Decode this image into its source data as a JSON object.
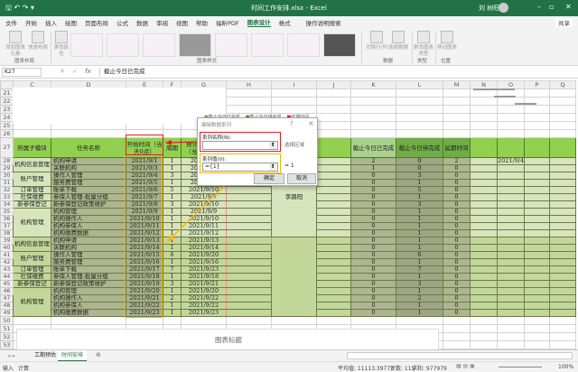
{
  "window": {
    "title": "时间工作安排.xlsx - Excel",
    "user": "刘 树旺",
    "share": "共享"
  },
  "menu": [
    "文件",
    "开始",
    "插入",
    "绘图",
    "页面布局",
    "公式",
    "数据",
    "审阅",
    "视图",
    "帮助",
    "福昕PDF",
    "图表设计",
    "格式"
  ],
  "menu_active": "图表设计",
  "tell_me": "操作说明搜索",
  "ribbon": {
    "add_element": "添加图表元素",
    "quick_layout": "快速布局",
    "change_colors": "更改颜色",
    "switch_row_col": "切换行/列",
    "select_data": "选择数据",
    "change_type": "更改图表类型",
    "move_chart": "移动图表",
    "groups": {
      "layout": "图表布局",
      "styles": "图表样式",
      "data": "数据",
      "type": "类型",
      "location": "位置"
    }
  },
  "formula": {
    "name_box": "K27",
    "value": "截止今日已完成",
    "fx": "fx"
  },
  "columns": [
    "C",
    "D",
    "E",
    "F",
    "G",
    "H",
    "I",
    "J",
    "K",
    "L",
    "M",
    "N",
    "O",
    "P",
    "Q"
  ],
  "top_rows": [
    {
      "row": 21,
      "c": "2021/9/21"
    },
    {
      "row": 22,
      "c": "2021/9/22"
    },
    {
      "row": 23,
      "c": "2021/9/23"
    },
    {
      "row": 24,
      "c": ""
    },
    {
      "row": 25,
      "c": ""
    },
    {
      "row": 26,
      "c": ""
    }
  ],
  "chart_legend": [
    "截止今日已完成",
    "截止今日待完成",
    "延期时间"
  ],
  "header": {
    "row": 27,
    "module": "所属子模块",
    "task": "任务名称",
    "start": "开始时间（当天0点）",
    "period": "周期",
    "end": "预计结束时间（当天24点）",
    "done": "截止今日已完成",
    "todo": "截止今日待完成",
    "delay": "延期时间"
  },
  "owner": "李路阳",
  "o28": "2021/9/4",
  "rows": [
    [
      28,
      "机构信息管理",
      "机构申请",
      "2021/9/1",
      "1",
      "2021/9/1",
      "2",
      "0",
      "2"
    ],
    [
      29,
      "",
      "关联机构",
      "2021/9/3",
      "1",
      "2021/9/3",
      "1",
      "0",
      "0"
    ],
    [
      30,
      "账户管理",
      "操作人管理",
      "2021/9/4",
      "3",
      "2021/9/6",
      "0",
      "3",
      "0"
    ],
    [
      31,
      "",
      "服务费管理",
      "2021/9/5",
      "1",
      "2021/9/5",
      "0",
      "1",
      "0"
    ],
    [
      32,
      "订单管理",
      "账单下载",
      "2021/9/6",
      "5",
      "2021/9/10",
      "0",
      "5",
      "0"
    ],
    [
      33,
      "社保缴费",
      "参保人管理-批量分组",
      "2021/9/7",
      "1",
      "2021/9/7",
      "0",
      "1",
      "0"
    ],
    [
      34,
      "新参保登记",
      "新参保登记政策维护",
      "2021/9/8",
      "3",
      "2021/9/10",
      "0",
      "3",
      "0"
    ],
    [
      35,
      "机构管理",
      "机构管理",
      "2021/9/9",
      "1",
      "2021/9/9",
      "0",
      "1",
      "0"
    ],
    [
      36,
      "",
      "机构操作人",
      "2021/9/10",
      "1",
      "2021/9/10",
      "0",
      "1",
      "0"
    ],
    [
      37,
      "",
      "机构参保人",
      "2021/9/11",
      "1",
      "2021/9/11",
      "0",
      "1",
      "0"
    ],
    [
      38,
      "",
      "机构缴费数据",
      "2021/9/12",
      "1",
      "2021/9/12",
      "0",
      "1",
      "0"
    ],
    [
      39,
      "机构信息管理",
      "机构申请",
      "2021/9/13",
      "1",
      "2021/9/13",
      "0",
      "1",
      "0"
    ],
    [
      40,
      "",
      "关联机构",
      "2021/9/14",
      "1",
      "2021/9/14",
      "0",
      "1",
      "0"
    ],
    [
      41,
      "账户管理",
      "操作人管理",
      "2021/9/15",
      "6",
      "2021/9/20",
      "0",
      "6",
      "0"
    ],
    [
      42,
      "",
      "服务费管理",
      "2021/9/16",
      "1",
      "2021/9/16",
      "0",
      "1",
      "0"
    ],
    [
      43,
      "订单管理",
      "账单下载",
      "2021/9/17",
      "7",
      "2021/9/23",
      "0",
      "7",
      "0"
    ],
    [
      44,
      "社保缴费",
      "参保人管理-批量分组",
      "2021/9/18",
      "1",
      "2021/9/18",
      "0",
      "1",
      "0"
    ],
    [
      45,
      "新参保登记",
      "新参保登记政策维护",
      "2021/9/19",
      "3",
      "2021/9/21",
      "0",
      "3",
      "0"
    ],
    [
      46,
      "机构管理",
      "机构管理",
      "2021/9/20",
      "1",
      "2021/9/20",
      "0",
      "1",
      "0"
    ],
    [
      47,
      "",
      "机构操作人",
      "2021/9/21",
      "2",
      "2021/9/22",
      "0",
      "2",
      "0"
    ],
    [
      48,
      "",
      "机构参保人",
      "2021/9/22",
      "1",
      "2021/9/22",
      "0",
      "1",
      "0"
    ],
    [
      49,
      "",
      "机构缴费数据",
      "2021/9/23",
      "1",
      "2021/9/23",
      "0",
      "1",
      "0"
    ]
  ],
  "bottom_rows": [
    50,
    51,
    52,
    53,
    54
  ],
  "dialog": {
    "title": "编辑数据系列",
    "help": "?",
    "close": "×",
    "name_label": "系列名称(N):",
    "name_value": "",
    "select_range": "选择区域",
    "values_label": "系列值(V):",
    "values_value": "={1}",
    "values_preview": "= 1",
    "ok": "确定",
    "cancel": "取消"
  },
  "bottom_chart": {
    "title": "图表标题",
    "axis": [
      "2021/9/1",
      "2021/9/3",
      "2021/9/5",
      "2021/9/7",
      "2021/9/9",
      "2021/9/11",
      "2021/9/13",
      "2021/9/15",
      "2021/9/17",
      "2021/9/19",
      "2021/9/21",
      "2021/9/23",
      "2021/9/25"
    ]
  },
  "sheet_tabs": [
    "工期预估",
    "时间安排"
  ],
  "active_sheet": "时间安排",
  "status": {
    "mode": "输入",
    "calc": "计算",
    "average": "平均值: 11113.39773",
    "count": "计数: 115",
    "sum": "求和: 977979",
    "zoom": "100%"
  },
  "colors": {
    "excel_green": "#217346",
    "header_green": "#92d050",
    "row_light": "#d8e4bc",
    "highlight_red": "#e02020",
    "highlight_orange": "#f5b800"
  }
}
